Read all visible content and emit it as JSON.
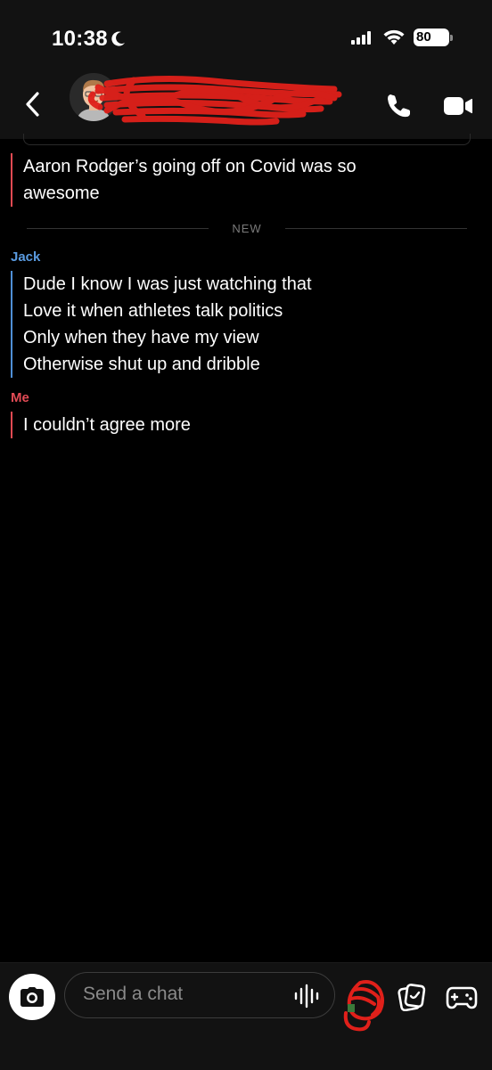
{
  "status_bar": {
    "time": "10:38",
    "battery": "80"
  },
  "header": {
    "contact_name_redacted": true
  },
  "messages": {
    "earlier": {
      "lines": [
        "Aaron Rodger’s going off on Covid was so",
        "awesome"
      ]
    },
    "divider_label": "NEW",
    "friend": {
      "sender": "Jack",
      "lines": [
        "Dude I know I was just watching that",
        "Love it when athletes talk politics",
        "Only when they have my view",
        "Otherwise shut up and dribble"
      ]
    },
    "me": {
      "sender": "Me",
      "lines": [
        "I couldn’t agree more"
      ]
    }
  },
  "composer": {
    "placeholder": "Send a chat"
  },
  "colors": {
    "me_accent": "#e24b55",
    "friend_accent": "#5a9be0",
    "background": "#000000",
    "bar_background": "#121212"
  },
  "icons": {
    "back": "chevron-left-icon",
    "call": "phone-icon",
    "video": "video-camera-icon",
    "camera": "camera-icon",
    "voice": "voice-wave-icon",
    "sticker": "sticker-icon",
    "memories": "memories-icon",
    "games": "gamepad-icon"
  }
}
